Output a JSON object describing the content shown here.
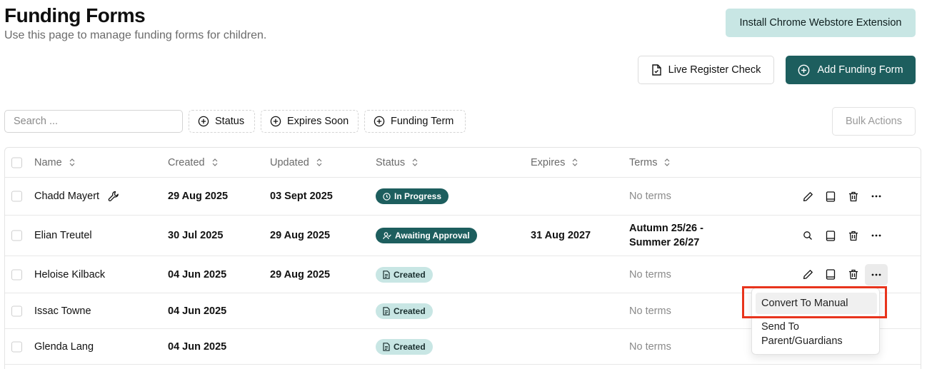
{
  "page": {
    "title": "Funding Forms",
    "subtitle": "Use this page to manage funding forms for children."
  },
  "buttons": {
    "install": "Install Chrome Webstore Extension",
    "live_register": "Live Register Check",
    "add_funding": "Add Funding Form",
    "bulk_actions": "Bulk Actions"
  },
  "search": {
    "placeholder": "Search ...",
    "value": ""
  },
  "filters": {
    "status": "Status",
    "expires_soon": "Expires Soon",
    "funding_term": "Funding Term"
  },
  "table": {
    "columns": {
      "name": "Name",
      "created": "Created",
      "updated": "Updated",
      "status": "Status",
      "expires": "Expires",
      "terms": "Terms"
    },
    "rows": [
      {
        "name": "Chadd Mayert",
        "created": "29 Aug 2025",
        "updated": "03 Sept 2025",
        "status": "In Progress",
        "status_icon": "clock-icon",
        "expires": "",
        "terms": "No terms",
        "first_action": "edit-icon"
      },
      {
        "name": "Elian Treutel",
        "created": "30 Jul 2025",
        "updated": "29 Aug 2025",
        "status": "Awaiting Approval",
        "status_icon": "user-check-icon",
        "expires": "31 Aug 2027",
        "terms": "Autumn 25/26 - Summer 26/27",
        "first_action": "search-icon"
      },
      {
        "name": "Heloise Kilback",
        "created": "04 Jun 2025",
        "updated": "29 Aug 2025",
        "status": "Created",
        "status_icon": "document-icon",
        "expires": "",
        "terms": "No terms",
        "first_action": "edit-icon"
      },
      {
        "name": "Issac Towne",
        "created": "04 Jun 2025",
        "updated": "",
        "status": "Created",
        "status_icon": "document-icon",
        "expires": "",
        "terms": "No terms",
        "first_action": ""
      },
      {
        "name": "Glenda Lang",
        "created": "04 Jun 2025",
        "updated": "",
        "status": "Created",
        "status_icon": "document-icon",
        "expires": "",
        "terms": "No terms",
        "first_action": ""
      }
    ]
  },
  "context_menu": {
    "items": [
      "Convert To Manual",
      "Send To Parent/Guardians"
    ]
  },
  "colors": {
    "accent": "#1d5e5e",
    "accent_light": "#c8e6e4",
    "highlight": "#e8341c"
  }
}
